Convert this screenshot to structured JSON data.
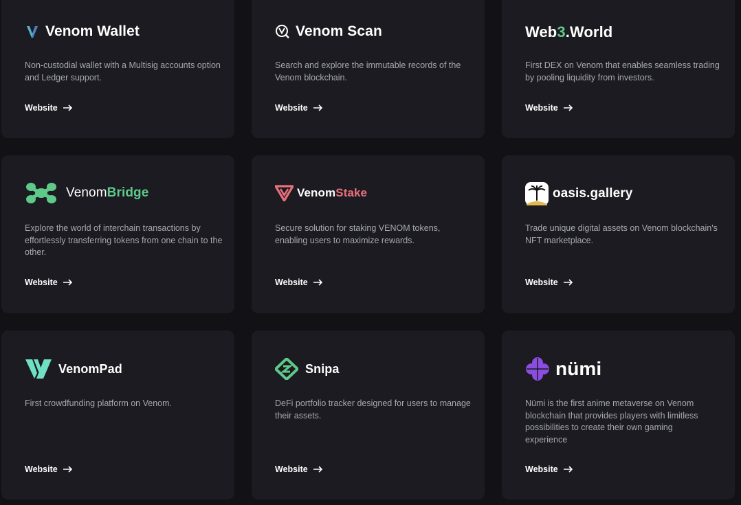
{
  "cards": [
    {
      "logo_icon": "venom-wallet-logo-icon",
      "name": "Venom Wallet",
      "description": "Non-custodial wallet with a Multisig accounts option and Ledger support.",
      "link_label": "Website"
    },
    {
      "logo_icon": "venom-scan-logo-icon",
      "name": "Venom Scan",
      "description": "Search and explore the immutable records of the Venom blockchain.",
      "link_label": "Website"
    },
    {
      "logo_icon": "web3-world-logo",
      "name_part1": "Web",
      "name_part2": "3",
      "name_part3": ".World",
      "description": "First DEX on Venom that enables seamless trading by pooling liquidity from investors.",
      "link_label": "Website"
    },
    {
      "logo_icon": "venom-bridge-logo-icon",
      "name_part1": "Venom",
      "name_part2": "Bridge",
      "description": "Explore the world of interchain transactions by effortlessly transferring tokens from one chain to the other.",
      "link_label": "Website"
    },
    {
      "logo_icon": "venom-stake-logo-icon",
      "name_part1": "Venom",
      "name_part2": "Stake",
      "description": "Secure solution for staking VENOM tokens, enabling users to maximize rewards.",
      "link_label": "Website"
    },
    {
      "logo_icon": "oasis-gallery-logo-icon",
      "name": "oasis.gallery",
      "description": "Trade unique digital assets on Venom blockchain's NFT marketplace.",
      "link_label": "Website"
    },
    {
      "logo_icon": "venom-pad-logo-icon",
      "name": "VenomPad",
      "description": "First crowdfunding platform on Venom.",
      "link_label": "Website"
    },
    {
      "logo_icon": "snipa-logo-icon",
      "name": "Snipa",
      "description": "DeFi portfolio tracker designed for users to manage their assets.",
      "link_label": "Website"
    },
    {
      "logo_icon": "numi-logo-icon",
      "name": "nümi",
      "description": "Nümi is the first anime metaverse on Venom blockchain that provides players with limitless possibilities to create their own gaming experience",
      "link_label": "Website"
    }
  ],
  "colors": {
    "page_bg": "#111116",
    "card_bg": "#1b1b21",
    "text_primary": "#ffffff",
    "text_secondary": "#a8a8b1",
    "accent_green": "#5fc98a",
    "accent_stake": "#e8707a",
    "numi_purple": "#8b4de0"
  }
}
